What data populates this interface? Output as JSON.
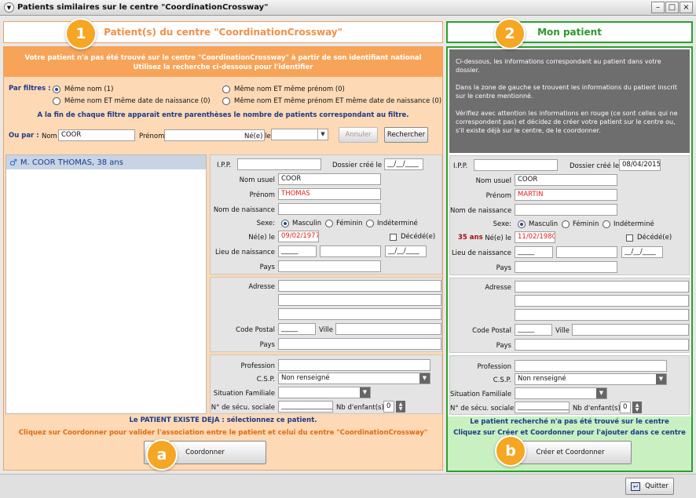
{
  "window": {
    "title": "Patients similaires sur le centre \"CoordinationCrossway\""
  },
  "left": {
    "header": "Patient(s) du centre \"CoordinationCrossway\"",
    "banner1": "Votre patient n'a pas été trouvé sur le centre \"CoordinationCrossway\" à partir de son identifiant national",
    "banner2": "Utilisez la recherche ci-dessous pour l'identifier",
    "filters_label": "Par filtres :",
    "filters": [
      {
        "label": "Même nom  (1)"
      },
      {
        "label": "Même nom ET même date de naissance  (0)"
      },
      {
        "label": "Même nom ET même prénom  (0)"
      },
      {
        "label": "Même nom ET même prénom ET même date de naissance  (0)"
      }
    ],
    "filter_hint": "A la fin de chaque filtre apparait entre parenthèses le nombre de patients correspondant au filtre.",
    "ou_par": "Ou par :",
    "nom_label": "Nom",
    "nom_value": "COOR",
    "prenom_label": "Prénom",
    "nele_label": "Né(e) le",
    "annuler": "Annuler",
    "rechercher": "Rechercher",
    "list": [
      {
        "label": "M. COOR THOMAS, 38 ans"
      }
    ],
    "form": {
      "ipp": "I.P.P.",
      "dossier": "Dossier créé le",
      "dossier_value": "__/__/____",
      "nom_usuel": "Nom usuel",
      "nom_usuel_value": "COOR",
      "prenom": "Prénom",
      "prenom_value": "THOMAS",
      "nom_naissance": "Nom de naissance",
      "sexe": "Sexe:",
      "masculin": "Masculin",
      "feminin": "Féminin",
      "indetermine": "Indéterminé",
      "nele": "Né(e) le",
      "nele_value": "09/02/1977",
      "decede": "Décédé(e)",
      "lieu": "Lieu de naissance",
      "lieu_value": "_____",
      "deces_value": "__/__/____",
      "pays": "Pays",
      "adresse": "Adresse",
      "code_postal": "Code Postal",
      "cp_value": "_____",
      "ville": "Ville",
      "profession": "Profession",
      "csp": "C.S.P.",
      "csp_value": "Non renseigné",
      "situation": "Situation Familiale",
      "secu": "N° de sécu. sociale",
      "secu_value": "________________",
      "nb_enfants": "Nb d'enfant(s)",
      "nb_enfants_value": "0"
    },
    "footer1": "Le PATIENT EXISTE DEJA : sélectionnez ce patient.",
    "footer2": "Cliquez sur Coordonner pour valider l'association entre le patient et celui du centre \"CoordinationCrossway\"",
    "coordonner": "Coordonner",
    "badge_num": "1",
    "badge_letter": "a"
  },
  "right": {
    "header": "Mon patient",
    "info": [
      "Ci-dessous, les informations correspondant au patient dans votre dossier.",
      "Dans la zone de gauche se trouvent les informations du patient inscrit sur le centre mentionné.",
      "Vérifiez avec attention les informations en rouge (ce sont celles qui ne correspondent pas) et décidez de créer votre patient sur le centre ou, s'il existe déjà sur le centre, de le coordonner."
    ],
    "form": {
      "dossier_value": "08/04/2015",
      "nom_usuel_value": "COOR",
      "prenom_value": "MARTIN",
      "age": "35 ans",
      "nele_value": "11/02/1980",
      "lieu_value": "_____",
      "deces_value": "__/__/____",
      "cp_value": "_____",
      "csp_value": "Non renseigné",
      "secu_value": "________________",
      "nb_enfants_value": "0"
    },
    "footer1": "Le patient recherché n'a pas été trouvé sur le centre",
    "footer2": "Cliquez sur Créer et Coordonner pour l'ajouter dans ce centre",
    "creer": "Créer et Coordonner",
    "badge_num": "2",
    "badge_letter": "b"
  },
  "quitter": "Quitter",
  "colors": {
    "orange": "#f7a459",
    "green": "#2aa02a",
    "badge": "#f5a623",
    "red": "#e02020"
  }
}
